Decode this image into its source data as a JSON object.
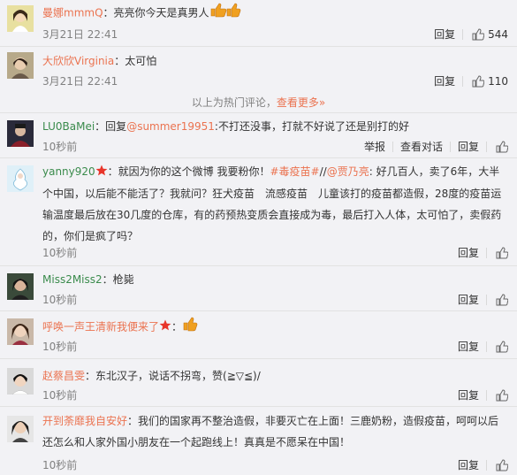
{
  "comments": [
    {
      "user": "曼娜mmmQ",
      "text": "：亮亮你今天是真男人",
      "time": "3月21日 22:41",
      "reply": "回复",
      "likes": "544"
    },
    {
      "user": "大欣欣Virginia",
      "text": "：太可怕",
      "time": "3月21日 22:41",
      "reply": "回复",
      "likes": "110"
    },
    {
      "user": "LU0BaMei",
      "text_pre": "：回复",
      "mention": "@summer19951",
      "text_post": ":不打还没事，打就不好说了还是别打的好",
      "time": "10秒前",
      "report": "举报",
      "view_conv": "查看对话",
      "reply": "回复"
    },
    {
      "user": "yanny920",
      "text_a": "：就因为你的这个微博 我要粉你！",
      "hashtag": "#毒疫苗#",
      "text_b": "//",
      "mention": "@贾乃亮",
      "text_c": ": 好几百人，卖了6年，大半个中国，以后能不能活了？我就问？狂犬疫苗　流感疫苗　儿童该打的疫苗都造假，28度的疫苗运输温度最后放在30几度的仓库，有的药预热变质会直接成为毒，最后打入人体，太可怕了，卖假药的，你们是疯了吗？",
      "time": "10秒前",
      "reply": "回复"
    },
    {
      "user": "Miss2Miss2",
      "text": "：枪毙",
      "time": "10秒前",
      "reply": "回复"
    },
    {
      "user": "呼唤一声王清新我便来了",
      "text": "：",
      "time": "10秒前",
      "reply": "回复"
    },
    {
      "user": "赵蔡昌雯",
      "text": "：东北汉子，说话不拐弯，赞(≧▽≦)/",
      "time": "10秒前",
      "reply": "回复"
    },
    {
      "user": "开到荼靡我自安好",
      "text": "：我们的国家再不整治造假，非要灭亡在上面！三鹿奶粉，造假疫苗，呵呵以后还怎么和人家外国小朋友在一个起跑线上！真真是不愿呆在中国！",
      "time": "10秒前",
      "reply": "回复"
    }
  ],
  "hot_notice": {
    "text": "以上为热门评论，",
    "more": "查看更多»"
  },
  "colors": {
    "username": "#eb7350",
    "link": "#eb7350",
    "background": "#f2f2f5"
  },
  "icons": {
    "like": "thumbs-up-icon",
    "vip_red": "star-badge-icon",
    "emoji": "thumbs-up-emoji-icon"
  }
}
